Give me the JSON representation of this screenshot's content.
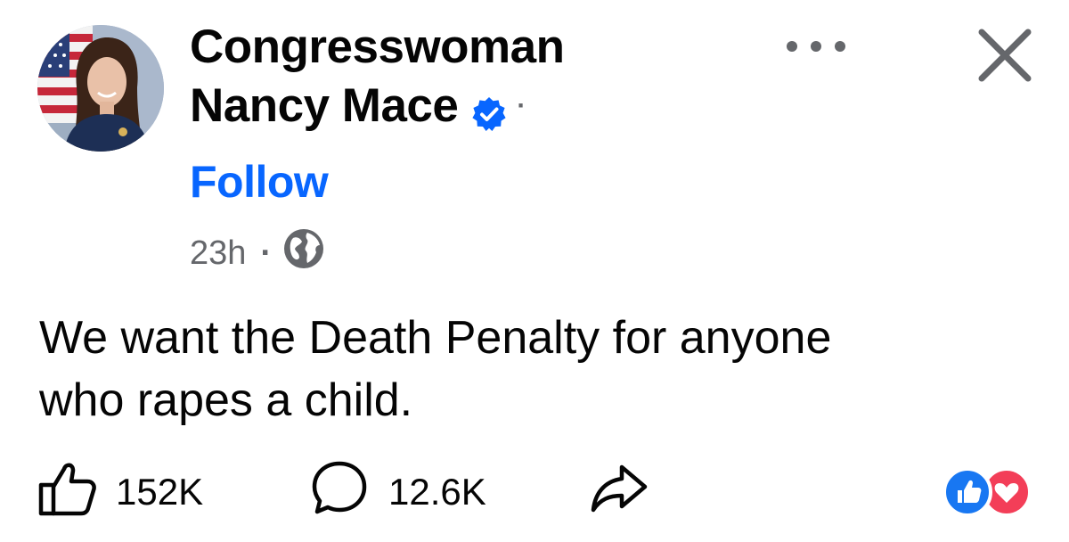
{
  "post": {
    "author": {
      "name_line1": "Congresswoman",
      "name_line2": "Nancy Mace",
      "verified": true,
      "name_dot": "·",
      "follow_label": "Follow"
    },
    "time": "23h",
    "time_separator": "·",
    "audience_icon": "globe-icon",
    "message_line1": "We want the Death Penalty for anyone",
    "message_line2": "who rapes a child.",
    "more_icon": "more-options-icon",
    "close_icon": "close-icon"
  },
  "actions": {
    "like_count": "152K",
    "comment_count": "12.6K",
    "like_icon": "thumbs-up-icon",
    "comment_icon": "comment-bubble-icon",
    "share_icon": "share-arrow-icon"
  },
  "reactions": [
    "like",
    "love"
  ],
  "colors": {
    "accent": "#0866ff",
    "secondary_text": "#65676b",
    "verified_badge": "#0866ff",
    "like_reaction": "#1877f2",
    "love_reaction": "#f33e58"
  }
}
